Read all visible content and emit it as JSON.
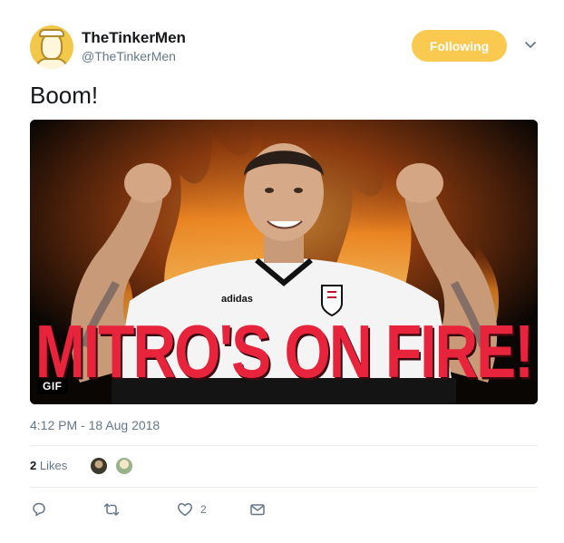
{
  "user": {
    "display_name": "TheTinkerMen",
    "handle": "@TheTinkerMen",
    "avatar_color": "#f2c84a"
  },
  "follow_button": {
    "label": "Following",
    "color": "#fac94f"
  },
  "tweet": {
    "text": "Boom!",
    "media": {
      "type": "gif",
      "badge": "GIF",
      "overlay_text": "MITRO'S ON FIRE!",
      "shirt_brand": "adidas"
    },
    "timestamp": "4:12 PM - 18 Aug 2018"
  },
  "stats": {
    "likes_count": "2",
    "likes_label": "Likes"
  },
  "actions": {
    "reply": {
      "icon": "reply-icon",
      "count": ""
    },
    "retweet": {
      "icon": "retweet-icon",
      "count": ""
    },
    "like": {
      "icon": "heart-icon",
      "count": "2"
    },
    "dm": {
      "icon": "envelope-icon",
      "count": ""
    }
  },
  "colors": {
    "text_secondary": "#657786",
    "divider": "#e6ecf0",
    "overlay_text": "#e8243c"
  }
}
